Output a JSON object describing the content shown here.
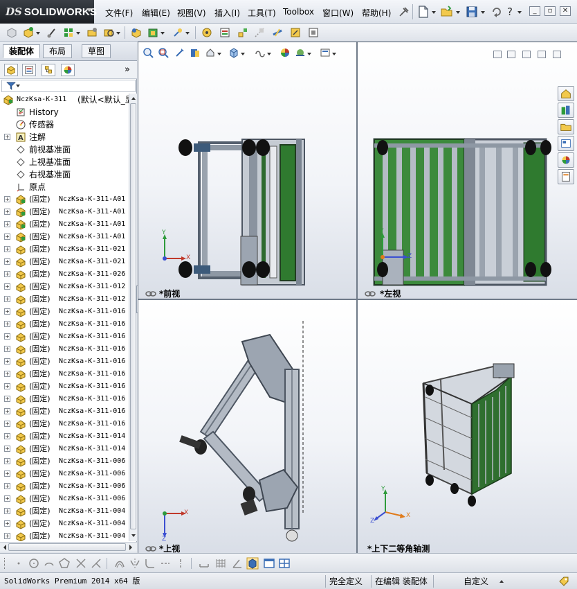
{
  "app": {
    "logo_prefix": "DS",
    "logo_text": "SOLIDWORKS"
  },
  "menu": [
    {
      "label": "文件(F)",
      "name": "menu-file"
    },
    {
      "label": "编辑(E)",
      "name": "menu-edit"
    },
    {
      "label": "视图(V)",
      "name": "menu-view"
    },
    {
      "label": "插入(I)",
      "name": "menu-insert"
    },
    {
      "label": "工具(T)",
      "name": "menu-tools"
    },
    {
      "label": "Toolbox",
      "name": "menu-toolbox"
    },
    {
      "label": "窗口(W)",
      "name": "menu-window"
    },
    {
      "label": "帮助(H)",
      "name": "menu-help"
    }
  ],
  "feature_manager": {
    "tabs": [
      "装配体",
      "布局",
      "草图"
    ],
    "root": {
      "name": "NczKsa-K-311",
      "config": "(默认<默认_显"
    },
    "items": [
      {
        "label": "History",
        "icon": "history-icon",
        "expandable": false
      },
      {
        "label": "传感器",
        "icon": "sensor-icon",
        "expandable": false
      },
      {
        "label": "注解",
        "icon": "annotation-icon",
        "expandable": true
      },
      {
        "label": "前视基准面",
        "icon": "plane-icon",
        "expandable": false
      },
      {
        "label": "上视基准面",
        "icon": "plane-icon",
        "expandable": false
      },
      {
        "label": "右视基准面",
        "icon": "plane-icon",
        "expandable": false
      },
      {
        "label": "原点",
        "icon": "origin-icon",
        "expandable": false
      }
    ],
    "components": [
      {
        "prefix": "(固定)",
        "name": "NczKsa-K-311-A01",
        "type": "assembly"
      },
      {
        "prefix": "(固定)",
        "name": "NczKsa-K-311-A01",
        "type": "assembly"
      },
      {
        "prefix": "(固定)",
        "name": "NczKsa-K-311-A01",
        "type": "assembly"
      },
      {
        "prefix": "(固定)",
        "name": "NczKsa-K-311-A01",
        "type": "assembly"
      },
      {
        "prefix": "(固定)",
        "name": "NczKsa-K-311-021",
        "type": "part"
      },
      {
        "prefix": "(固定)",
        "name": "NczKsa-K-311-021",
        "type": "part"
      },
      {
        "prefix": "(固定)",
        "name": "NczKsa-K-311-026",
        "type": "part"
      },
      {
        "prefix": "(固定)",
        "name": "NczKsa-K-311-012",
        "type": "part"
      },
      {
        "prefix": "(固定)",
        "name": "NczKsa-K-311-012",
        "type": "part"
      },
      {
        "prefix": "(固定)",
        "name": "NczKsa-K-311-016",
        "type": "part"
      },
      {
        "prefix": "(固定)",
        "name": "NczKsa-K-311-016",
        "type": "part"
      },
      {
        "prefix": "(固定)",
        "name": "NczKsa-K-311-016",
        "type": "part"
      },
      {
        "prefix": "(固定)",
        "name": "NczKsa-K-311-016",
        "type": "part"
      },
      {
        "prefix": "(固定)",
        "name": "NczKsa-K-311-016",
        "type": "part"
      },
      {
        "prefix": "(固定)",
        "name": "NczKsa-K-311-016",
        "type": "part"
      },
      {
        "prefix": "(固定)",
        "name": "NczKsa-K-311-016",
        "type": "part"
      },
      {
        "prefix": "(固定)",
        "name": "NczKsa-K-311-016",
        "type": "part"
      },
      {
        "prefix": "(固定)",
        "name": "NczKsa-K-311-016",
        "type": "part"
      },
      {
        "prefix": "(固定)",
        "name": "NczKsa-K-311-016",
        "type": "part"
      },
      {
        "prefix": "(固定)",
        "name": "NczKsa-K-311-014",
        "type": "part"
      },
      {
        "prefix": "(固定)",
        "name": "NczKsa-K-311-014",
        "type": "part"
      },
      {
        "prefix": "(固定)",
        "name": "NczKsa-K-311-006",
        "type": "part"
      },
      {
        "prefix": "(固定)",
        "name": "NczKsa-K-311-006",
        "type": "part"
      },
      {
        "prefix": "(固定)",
        "name": "NczKsa-K-311-006",
        "type": "part"
      },
      {
        "prefix": "(固定)",
        "name": "NczKsa-K-311-006",
        "type": "part"
      },
      {
        "prefix": "(固定)",
        "name": "NczKsa-K-311-004",
        "type": "part"
      },
      {
        "prefix": "(固定)",
        "name": "NczKsa-K-311-004",
        "type": "part"
      },
      {
        "prefix": "(固定)",
        "name": "NczKsa-K-311-004",
        "type": "part"
      }
    ]
  },
  "viewports": {
    "front": "*前视",
    "left": "*左视",
    "top": "*上视",
    "iso": "*上下二等角轴测"
  },
  "triad": {
    "x": "X",
    "y": "Y",
    "z": "Z"
  },
  "status": {
    "product": "SolidWorks Premium 2014 x64 版",
    "definition": "完全定义",
    "editing": "在编辑 装配体",
    "units": "自定义"
  }
}
